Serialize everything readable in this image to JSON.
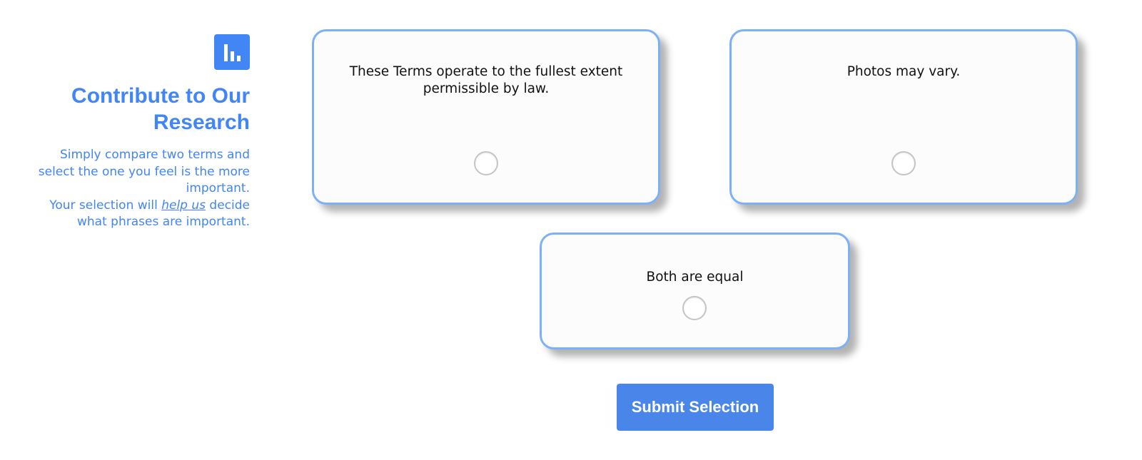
{
  "sidebar": {
    "logo_icon": "bar-chart-icon",
    "heading_line1": "Contribute to Our",
    "heading_line2": "Research",
    "desc_part1": "Simply compare two terms and select the one you feel is the more important.",
    "desc_part2": "Your selection will ",
    "desc_emphasis": "help us",
    "desc_part3": " decide what phrases are important."
  },
  "options": {
    "option_a": {
      "text": "These Terms operate to the fullest extent permissible by law.",
      "selected": false
    },
    "option_b": {
      "text": "Photos may vary.",
      "selected": false
    },
    "option_equal": {
      "text": "Both are equal",
      "selected": false
    }
  },
  "submit": {
    "label": "Submit Selection"
  },
  "colors": {
    "accent": "#4285f4",
    "card_border": "#7db1f7",
    "button": "#4a86ea"
  }
}
